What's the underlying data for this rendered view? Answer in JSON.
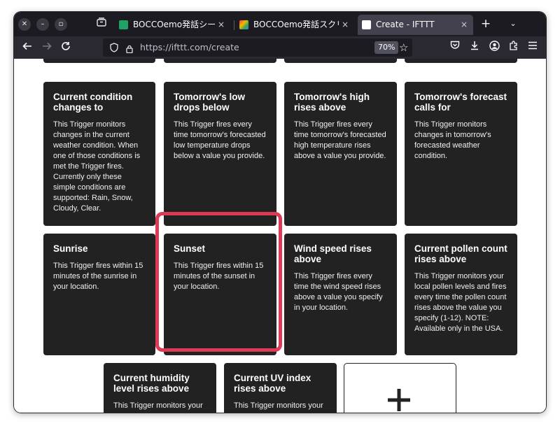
{
  "browser": {
    "tabs": [
      {
        "label": "BOCCOemo発話シート - Go",
        "favicon_color": "#1fa463",
        "active": false
      },
      {
        "label": "BOCCOemo発話スクリプト",
        "favicon_color": "#e8453c",
        "active": false
      },
      {
        "label": "Create - IFTTT",
        "favicon_color": "#ffffff",
        "active": true
      }
    ],
    "url": "https://ifttt.com/create",
    "zoom": "70%",
    "close_glyph": "×",
    "new_tab_glyph": "+",
    "tab_menu_glyph": "⌄"
  },
  "triggers": [
    {
      "title": "Current condition changes to",
      "description": "This Trigger monitors changes in the current weather condition. When one of those conditions is met the Trigger fires. Currently only these simple conditions are supported: Rain, Snow, Cloudy, Clear."
    },
    {
      "title": "Tomorrow's low drops below",
      "description": "This Trigger fires every time tomorrow's forecasted low temperature drops below a value you provide."
    },
    {
      "title": "Tomorrow's high rises above",
      "description": "This Trigger fires every time tomorrow's forecasted high temperature rises above a value you provide."
    },
    {
      "title": "Tomorrow's forecast calls for",
      "description": "This Trigger monitors changes in tomorrow's forecasted weather condition."
    },
    {
      "title": "Sunrise",
      "description": "This Trigger fires within 15 minutes of the sunrise in your location."
    },
    {
      "title": "Sunset",
      "description": "This Trigger fires within 15 minutes of the sunset in your location."
    },
    {
      "title": "Wind speed rises above",
      "description": "This Trigger fires every time the wind speed rises above a value you specify in your location."
    },
    {
      "title": "Current pollen count rises above",
      "description": "This Trigger monitors your local pollen levels and fires every time the pollen count rises above the value you specify (1-12). NOTE: Available only in the USA."
    },
    {
      "title": "Current humidity level rises above",
      "description": "This Trigger monitors your local humidity and fires"
    },
    {
      "title": "Current UV index rises above",
      "description": "This Trigger monitors your local UV levels and fires"
    }
  ],
  "colors": {
    "card_bg": "#222222",
    "highlight": "#dc3a55",
    "browser_dark": "#1c1b22"
  }
}
